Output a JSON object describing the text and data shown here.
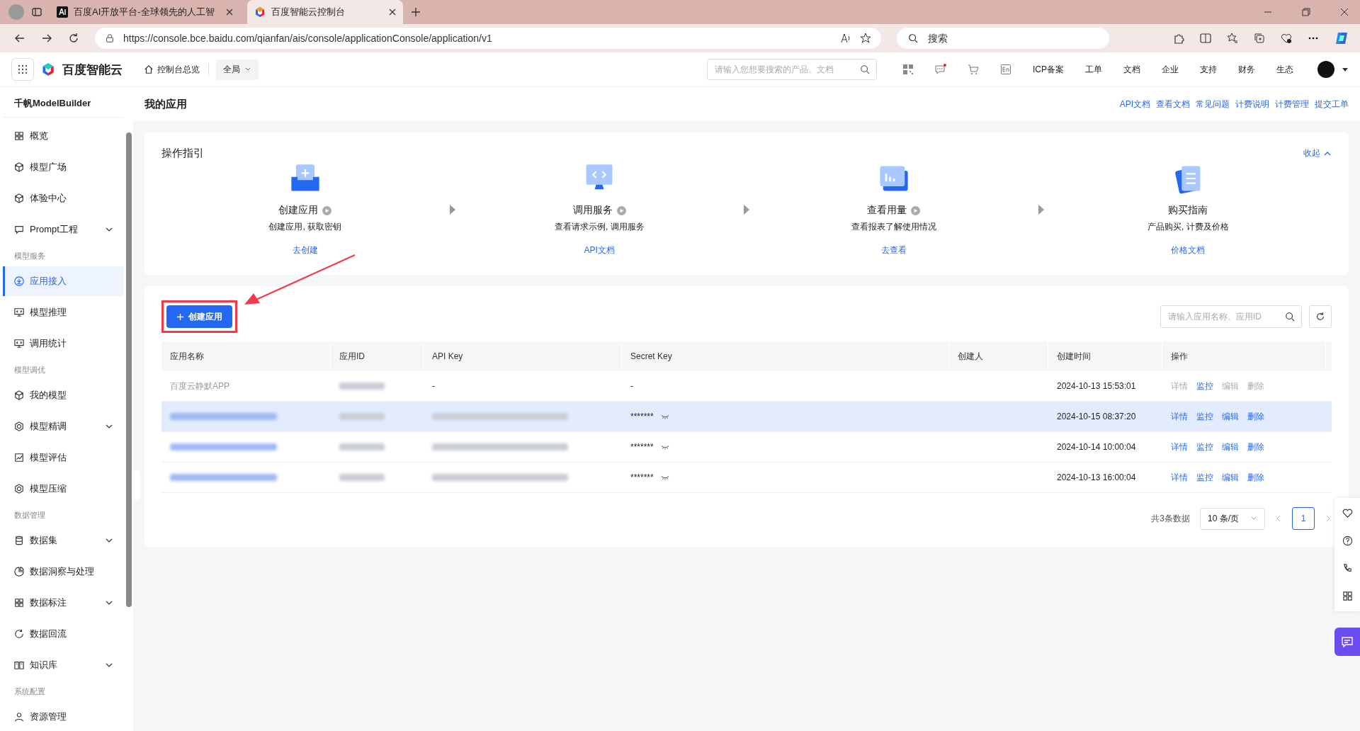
{
  "browser": {
    "tabs": [
      {
        "title": "百度AI开放平台-全球领先的人工智",
        "selected": false,
        "kind": "ai"
      },
      {
        "title": "百度智能云控制台",
        "selected": true,
        "kind": "cloud"
      }
    ],
    "url": "https://console.bce.baidu.com/qianfan/ais/console/applicationConsole/application/v1",
    "search_placeholder": "搜索"
  },
  "header": {
    "logo": "百度智能云",
    "home": "控制台总览",
    "scope": "全局",
    "search_placeholder": "请输入您想要搜索的产品、文档",
    "links": [
      "ICP备案",
      "工单",
      "文档",
      "企业",
      "支持",
      "财务",
      "生态"
    ]
  },
  "sidebar": {
    "title": "千帆ModelBuilder",
    "items": [
      {
        "kind": "item",
        "label": "概览",
        "expandable": false,
        "selected": false
      },
      {
        "kind": "item",
        "label": "模型广场",
        "expandable": false,
        "selected": false
      },
      {
        "kind": "item",
        "label": "体验中心",
        "expandable": false,
        "selected": false
      },
      {
        "kind": "item",
        "label": "Prompt工程",
        "expandable": true,
        "selected": false
      },
      {
        "kind": "heading",
        "label": "模型服务"
      },
      {
        "kind": "item",
        "label": "应用接入",
        "expandable": false,
        "selected": true
      },
      {
        "kind": "item",
        "label": "模型推理",
        "expandable": false,
        "selected": false
      },
      {
        "kind": "item",
        "label": "调用统计",
        "expandable": false,
        "selected": false
      },
      {
        "kind": "heading",
        "label": "模型调优"
      },
      {
        "kind": "item",
        "label": "我的模型",
        "expandable": false,
        "selected": false
      },
      {
        "kind": "item",
        "label": "模型精调",
        "expandable": true,
        "selected": false
      },
      {
        "kind": "item",
        "label": "模型评估",
        "expandable": false,
        "selected": false
      },
      {
        "kind": "item",
        "label": "模型压缩",
        "expandable": false,
        "selected": false
      },
      {
        "kind": "heading",
        "label": "数据管理"
      },
      {
        "kind": "item",
        "label": "数据集",
        "expandable": true,
        "selected": false
      },
      {
        "kind": "item",
        "label": "数据洞察与处理",
        "expandable": false,
        "selected": false
      },
      {
        "kind": "item",
        "label": "数据标注",
        "expandable": true,
        "selected": false
      },
      {
        "kind": "item",
        "label": "数据回流",
        "expandable": false,
        "selected": false
      },
      {
        "kind": "item",
        "label": "知识库",
        "expandable": true,
        "selected": false
      },
      {
        "kind": "heading",
        "label": "系统配置"
      },
      {
        "kind": "item",
        "label": "资源管理",
        "expandable": false,
        "selected": false
      }
    ]
  },
  "page": {
    "title": "我的应用",
    "links": [
      "API文档",
      "查看文档",
      "常见问题",
      "计费说明",
      "计费管理",
      "提交工单"
    ]
  },
  "guide": {
    "title": "操作指引",
    "collapse": "收起",
    "steps": [
      {
        "title": "创建应用",
        "desc": "创建应用, 获取密钥",
        "link": "去创建",
        "play": true
      },
      {
        "title": "调用服务",
        "desc": "查看请求示例, 调用服务",
        "link": "API文档",
        "play": true
      },
      {
        "title": "查看用量",
        "desc": "查看报表了解使用情况",
        "link": "去查看",
        "play": true
      },
      {
        "title": "购买指南",
        "desc": "产品购买, 计费及价格",
        "link": "价格文档",
        "play": false
      }
    ]
  },
  "table": {
    "create_button": "创建应用",
    "highlight": true,
    "search_placeholder": "请输入应用名称、应用ID",
    "columns": [
      "应用名称",
      "应用ID",
      "API Key",
      "Secret Key",
      "创建人",
      "创建时间",
      "操作"
    ],
    "rows": [
      {
        "selected": false,
        "disabled": true,
        "cells": [
          {
            "kind": "text",
            "text": "百度云静默APP"
          },
          {
            "kind": "blurred"
          },
          {
            "kind": "text",
            "text": "-"
          },
          {
            "kind": "text",
            "text": "-"
          },
          {
            "kind": "empty"
          },
          {
            "kind": "text",
            "text": "2024-10-13 15:53:01"
          }
        ],
        "actions": [
          {
            "label": "详情",
            "disabled": true
          },
          {
            "label": "监控",
            "disabled": false
          },
          {
            "label": "编辑",
            "disabled": true
          },
          {
            "label": "删除",
            "disabled": true
          }
        ]
      },
      {
        "selected": true,
        "disabled": false,
        "cells": [
          {
            "kind": "blurred-link"
          },
          {
            "kind": "blurred"
          },
          {
            "kind": "blurred"
          },
          {
            "kind": "secret",
            "text": "*******"
          },
          {
            "kind": "empty"
          },
          {
            "kind": "text",
            "text": "2024-10-15 08:37:20"
          }
        ],
        "actions": [
          {
            "label": "详情",
            "disabled": false
          },
          {
            "label": "监控",
            "disabled": false
          },
          {
            "label": "编辑",
            "disabled": false
          },
          {
            "label": "删除",
            "disabled": false
          }
        ]
      },
      {
        "selected": false,
        "disabled": false,
        "cells": [
          {
            "kind": "blurred-link"
          },
          {
            "kind": "blurred"
          },
          {
            "kind": "blurred"
          },
          {
            "kind": "secret",
            "text": "*******"
          },
          {
            "kind": "empty"
          },
          {
            "kind": "text",
            "text": "2024-10-14 10:00:04"
          }
        ],
        "actions": [
          {
            "label": "详情",
            "disabled": false
          },
          {
            "label": "监控",
            "disabled": false
          },
          {
            "label": "编辑",
            "disabled": false
          },
          {
            "label": "删除",
            "disabled": false
          }
        ]
      },
      {
        "selected": false,
        "disabled": false,
        "cells": [
          {
            "kind": "blurred-link"
          },
          {
            "kind": "blurred"
          },
          {
            "kind": "blurred"
          },
          {
            "kind": "secret",
            "text": "*******"
          },
          {
            "kind": "empty"
          },
          {
            "kind": "text",
            "text": "2024-10-13 16:00:04"
          }
        ],
        "actions": [
          {
            "label": "详情",
            "disabled": false
          },
          {
            "label": "监控",
            "disabled": false
          },
          {
            "label": "编辑",
            "disabled": false
          },
          {
            "label": "删除",
            "disabled": false
          }
        ]
      }
    ],
    "total": "共3条数据",
    "page_size": "10 条/页",
    "pages": [
      {
        "label": "1",
        "selected": true
      }
    ]
  }
}
